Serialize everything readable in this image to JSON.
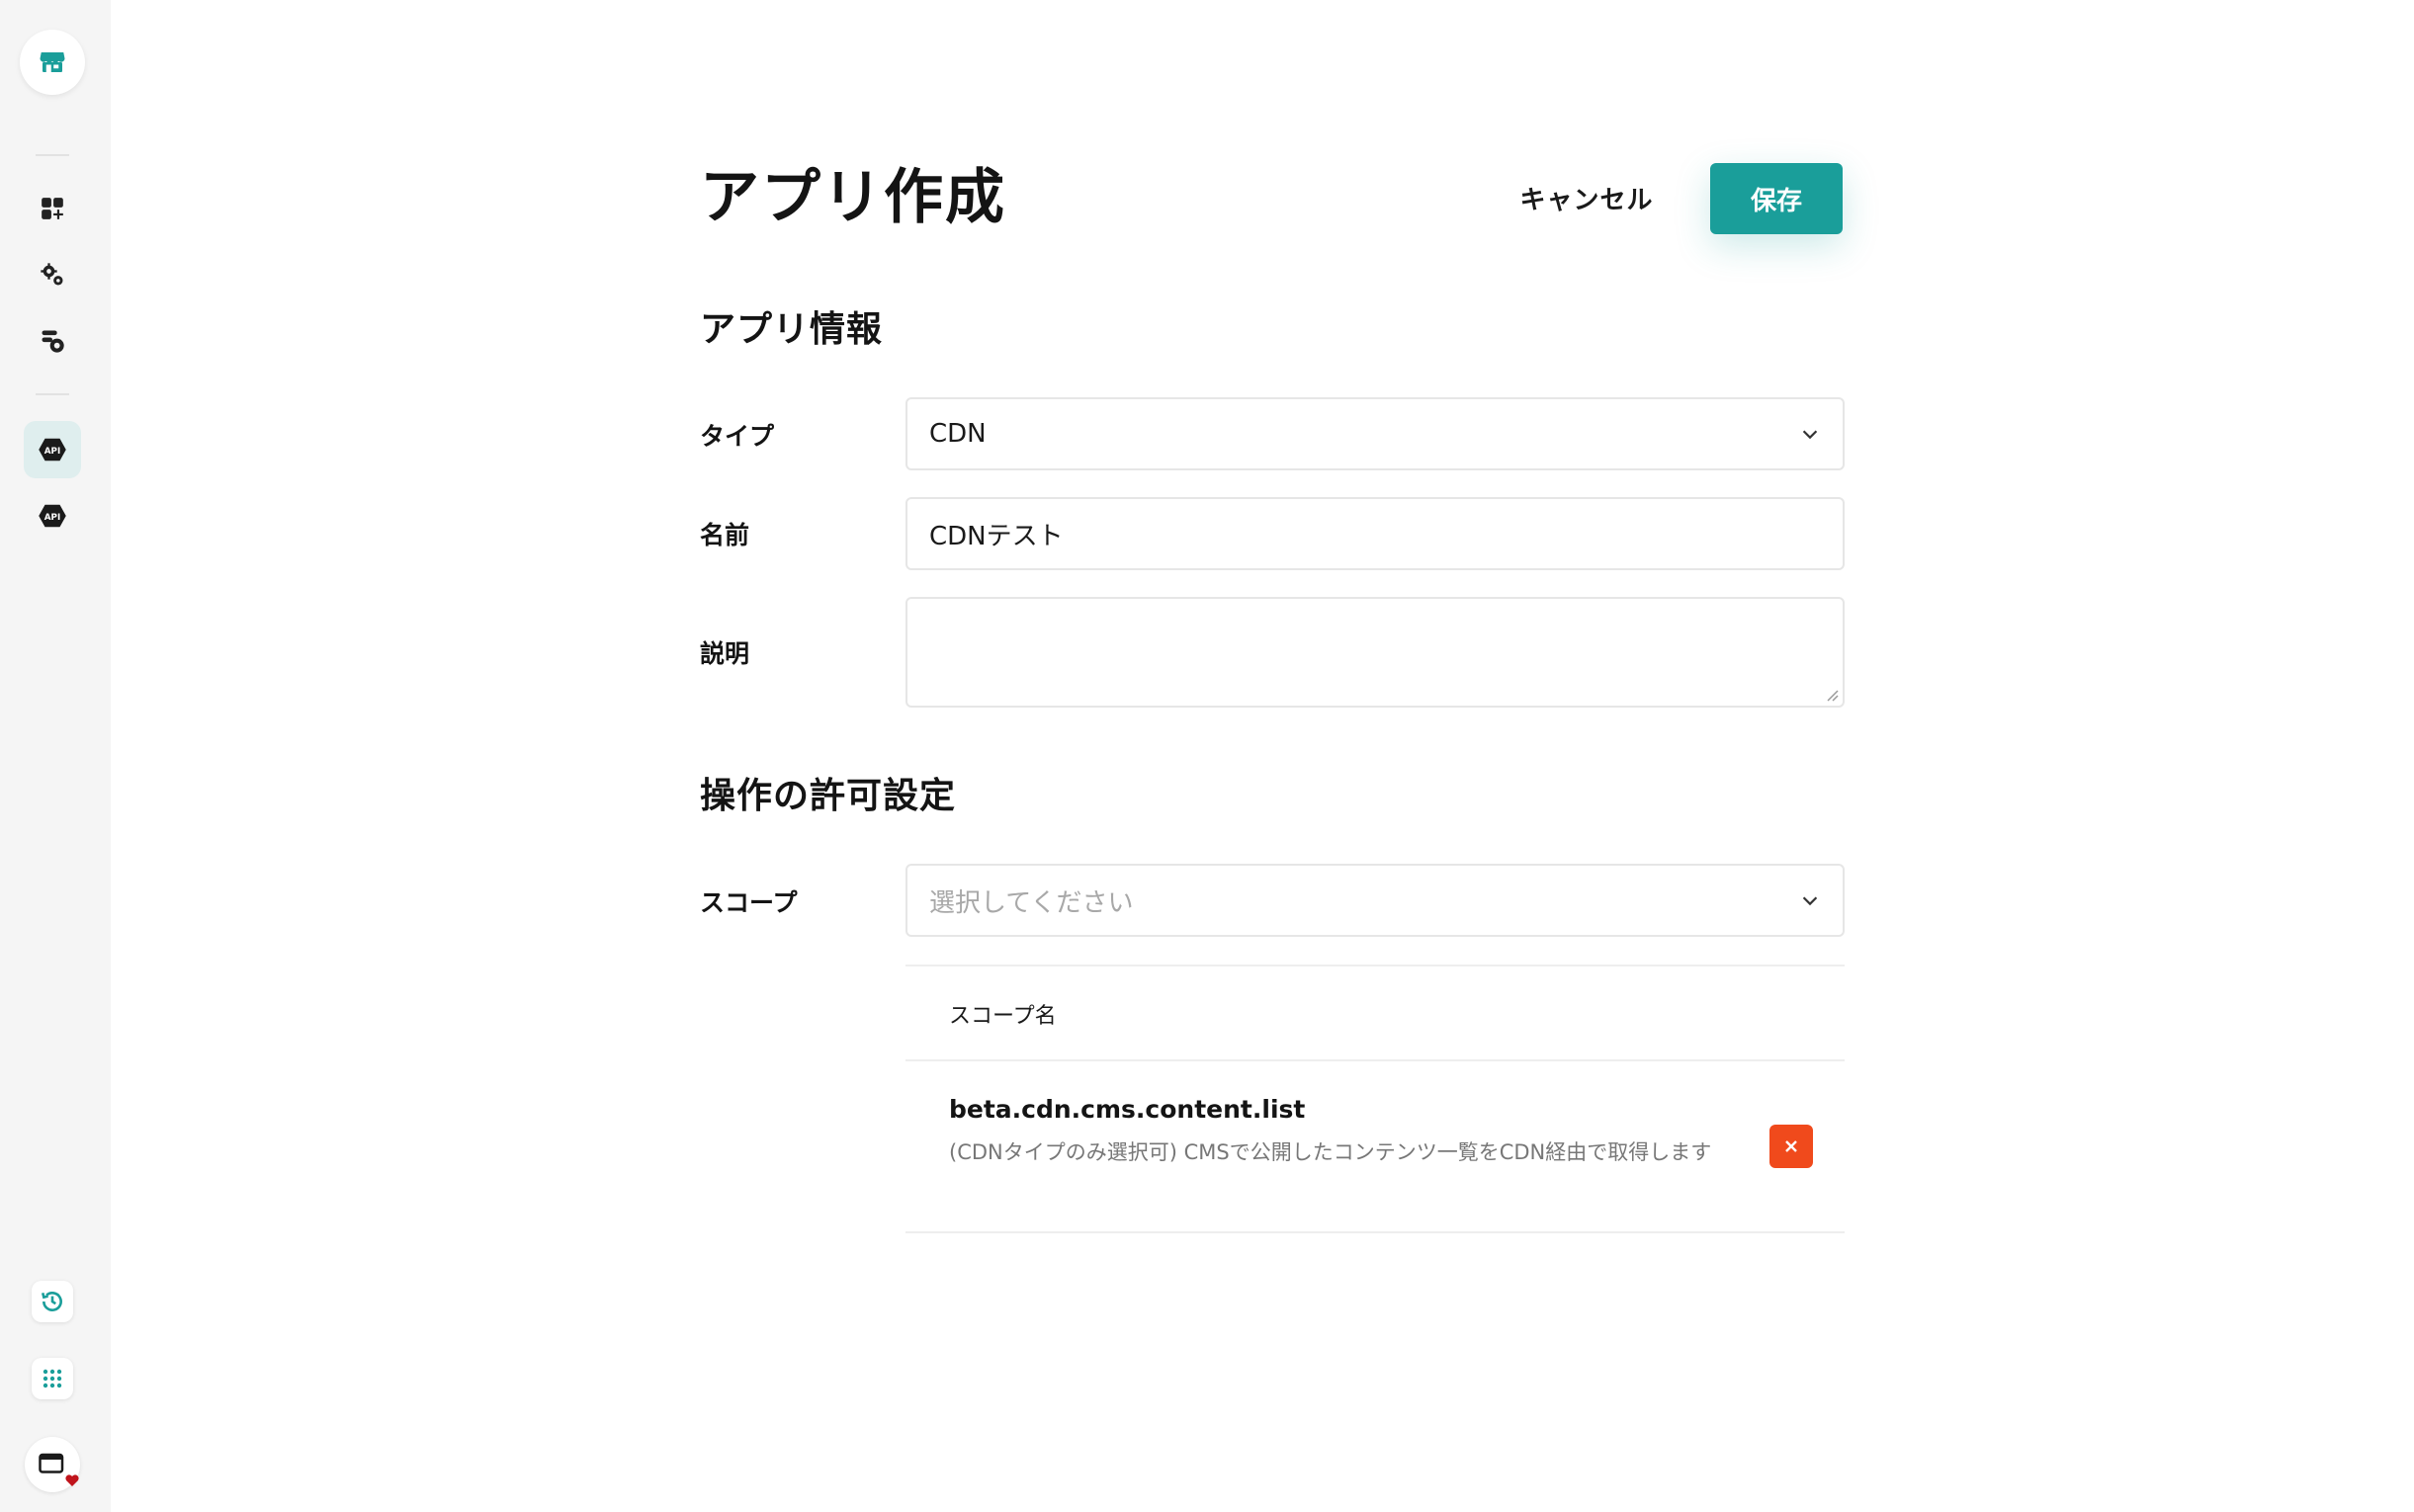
{
  "sidebar": {
    "logo_icon": "storefront-icon",
    "items": [
      {
        "icon": "dashboard-add-icon",
        "active": false
      },
      {
        "icon": "gears-icon",
        "active": false
      },
      {
        "icon": "database-settings-icon",
        "active": false
      },
      {
        "icon": "api-icon",
        "active": true
      },
      {
        "icon": "api-icon",
        "active": false
      }
    ],
    "bottom": [
      {
        "icon": "history-icon"
      },
      {
        "icon": "apps-grid-icon"
      },
      {
        "icon": "window-icon"
      }
    ]
  },
  "header": {
    "title": "アプリ作成",
    "cancel_label": "キャンセル",
    "save_label": "保存"
  },
  "app_info": {
    "section_title": "アプリ情報",
    "type_label": "タイプ",
    "type_value": "CDN",
    "name_label": "名前",
    "name_value": "CDNテスト",
    "description_label": "説明",
    "description_value": ""
  },
  "permissions": {
    "section_title": "操作の許可設定",
    "scope_label": "スコープ",
    "scope_placeholder": "選択してください",
    "table_header": "スコープ名",
    "scopes": [
      {
        "name": "beta.cdn.cms.content.list",
        "description": "(CDNタイプのみ選択可) CMSで公開したコンテンツ一覧をCDN経由で取得します"
      }
    ]
  },
  "colors": {
    "accent": "#1a9e9a",
    "danger": "#f04a1c",
    "sidebar_bg": "#f5f5f5"
  }
}
